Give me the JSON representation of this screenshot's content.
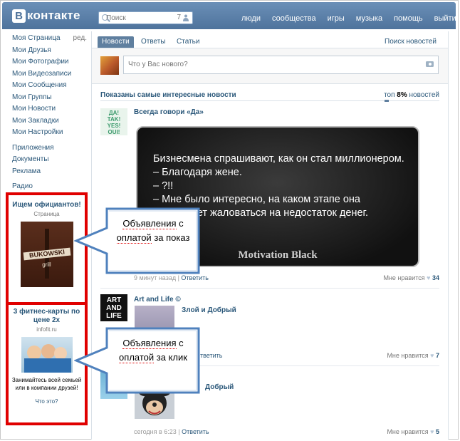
{
  "header": {
    "logo_letter": "В",
    "logo_text": "контакте",
    "search_placeholder": "Поиск",
    "search_count": "7",
    "nav": [
      "люди",
      "сообщества",
      "игры",
      "музыка",
      "помощь",
      "выйти"
    ]
  },
  "left_menu": {
    "edit": "ред.",
    "items": [
      "Моя Страница",
      "Мои Друзья",
      "Мои Фотографии",
      "Мои Видеозаписи",
      "Мои Сообщения",
      "Мои Группы",
      "Мои Новости",
      "Мои Закладки",
      "Мои Настройки"
    ],
    "extra": [
      "Приложения",
      "Документы",
      "Реклама"
    ],
    "radio": "Радио"
  },
  "ads": [
    {
      "title": "Ищем официантов!",
      "subtitle": "Страница",
      "image_text": [
        "BUKOWSKI",
        "grill"
      ]
    },
    {
      "title": "3 фитнес-карты по цене 2х",
      "subtitle": "infofit.ru",
      "description": "Занимайтесь всей семьей или в компании друзей!",
      "what": "Что это?"
    }
  ],
  "tabs": {
    "news": "Новости",
    "replies": "Ответы",
    "articles": "Статьи",
    "search_news": "Поиск новостей"
  },
  "composer": {
    "placeholder": "Что у Вас нового?"
  },
  "feed": {
    "header": "Показаны самые интересные новости",
    "filter_prefix": "топ ",
    "filter_percent": "8%",
    "filter_suffix": " новостей"
  },
  "posts": [
    {
      "author": "Всегда говори «Да»",
      "avatar_text": [
        "ДА!",
        "TAK!",
        "YES!",
        "OUI!"
      ],
      "image_lines": [
        "Бизнесмена спрашивают, как он стал миллионером.",
        "– Благодаря жене.",
        "– ?!!",
        "– Мне было интересно, на каком этапе она",
        "перестанет жаловаться на недостаток денег."
      ],
      "image_brand": "Motivation Black",
      "time": "9 минут назад",
      "reply": "Ответить",
      "like_label": "Мне нравится",
      "likes": "34"
    },
    {
      "author": "Art and Life ©",
      "avatar_text": [
        "ART",
        "AND",
        "LIFE"
      ],
      "subauthor": "Злой и Добрый",
      "reply": "Ответить",
      "like_label": "Мне нравится",
      "likes": "7"
    },
    {
      "author": "Добрый",
      "time": "сегодня в 6:23",
      "reply": "Ответить",
      "like_label": "Мне нравится",
      "likes": "5"
    }
  ],
  "callouts": [
    {
      "line1a": "Объявления",
      "line1b": " с",
      "line2a": "оплатой",
      "line2b": " за показ"
    },
    {
      "line1a": "Объявления",
      "line1b": " с",
      "line2a": "оплатой",
      "line2b": " за клик"
    }
  ],
  "colors": {
    "header": "#5b7fa6",
    "link": "#2b587a",
    "ad_border": "#e00000",
    "callout_border": "#4f81bd"
  }
}
